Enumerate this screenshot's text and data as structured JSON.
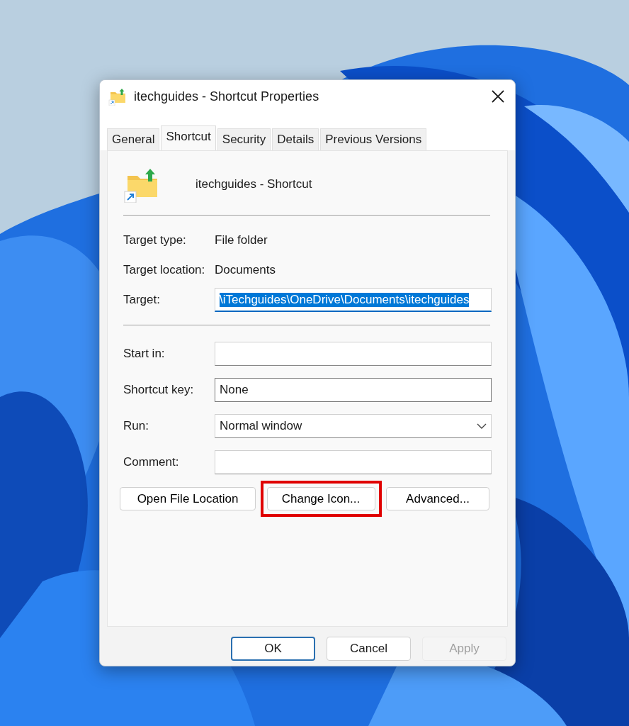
{
  "window": {
    "title": "itechguides - Shortcut Properties"
  },
  "tabs": [
    {
      "label": "General",
      "selected": false
    },
    {
      "label": "Shortcut",
      "selected": true
    },
    {
      "label": "Security",
      "selected": false
    },
    {
      "label": "Details",
      "selected": false
    },
    {
      "label": "Previous Versions",
      "selected": false
    }
  ],
  "header": {
    "name": "itechguides - Shortcut"
  },
  "info": [
    {
      "label": "Target type:",
      "value": "File folder"
    },
    {
      "label": "Target location:",
      "value": "Documents"
    }
  ],
  "target": {
    "label": "Target:",
    "value": "\\iTechguides\\OneDrive\\Documents\\itechguides",
    "text_selected": true,
    "focused": true
  },
  "fields": [
    {
      "kind": "input",
      "label": "Start in:"
    },
    {
      "kind": "input",
      "label": "Shortcut key:",
      "value": "None"
    },
    {
      "kind": "select",
      "label": "Run:",
      "value": "Normal window"
    },
    {
      "kind": "input",
      "label": "Comment:"
    }
  ],
  "actions": [
    {
      "label": "Open File Location",
      "highlighted": false
    },
    {
      "label": "Change Icon...",
      "highlighted": true
    },
    {
      "label": "Advanced...",
      "highlighted": false
    }
  ],
  "buttons": [
    {
      "label": "OK",
      "default": true,
      "disabled": false
    },
    {
      "label": "Cancel",
      "default": false,
      "disabled": false
    },
    {
      "label": "Apply",
      "default": false,
      "disabled": true
    }
  ]
}
